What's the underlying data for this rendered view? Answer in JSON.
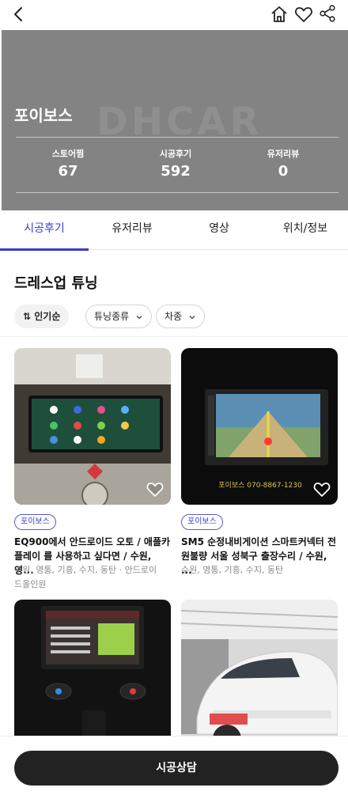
{
  "store": {
    "name": "포이보스",
    "stats": [
      {
        "label": "스토어찜",
        "value": "67"
      },
      {
        "label": "시공후기",
        "value": "592"
      },
      {
        "label": "유저리뷰",
        "value": "0"
      }
    ]
  },
  "tabs": [
    {
      "label": "시공후기",
      "active": true
    },
    {
      "label": "유저리뷰",
      "active": false
    },
    {
      "label": "영상",
      "active": false
    },
    {
      "label": "위치/정보",
      "active": false
    }
  ],
  "section": {
    "title": "드레스업 튜닝",
    "filters": {
      "sort": "⇅ 인기순",
      "tuning_type": "튜닝종류",
      "car_model": "차종"
    }
  },
  "cards": [
    {
      "tag": "포이보스",
      "title_line1": "EQ900에서 안드로이드 오토 / 애플카",
      "title_line2": "플레이 를 사용하고 싶다면 / 수원, 영...",
      "meta_line1": "수원, 영통, 기흥, 수지, 동탄 · 안드로이",
      "meta_line2": "드올인원",
      "image": "car-dashboard-carplay-screen"
    },
    {
      "tag": "포이보스",
      "title_line1": "SM5 순정내비게이션 스마트커넥터 전",
      "title_line2": "원불량 서울 성북구 출장수리 / 수원, ...",
      "meta_line1": "수원, 영통, 기흥, 수지, 동탄",
      "image": "car-navigation-screen",
      "image_caption": "포이보스 070-8867-1230"
    },
    {
      "image": "car-interior-media-screen"
    },
    {
      "image": "white-suv-in-garage"
    }
  ],
  "cta": {
    "label": "시공상담"
  },
  "colors": {
    "accent": "#3a3ad0",
    "hero_bg": "#838383",
    "cta_bg": "#222222"
  }
}
